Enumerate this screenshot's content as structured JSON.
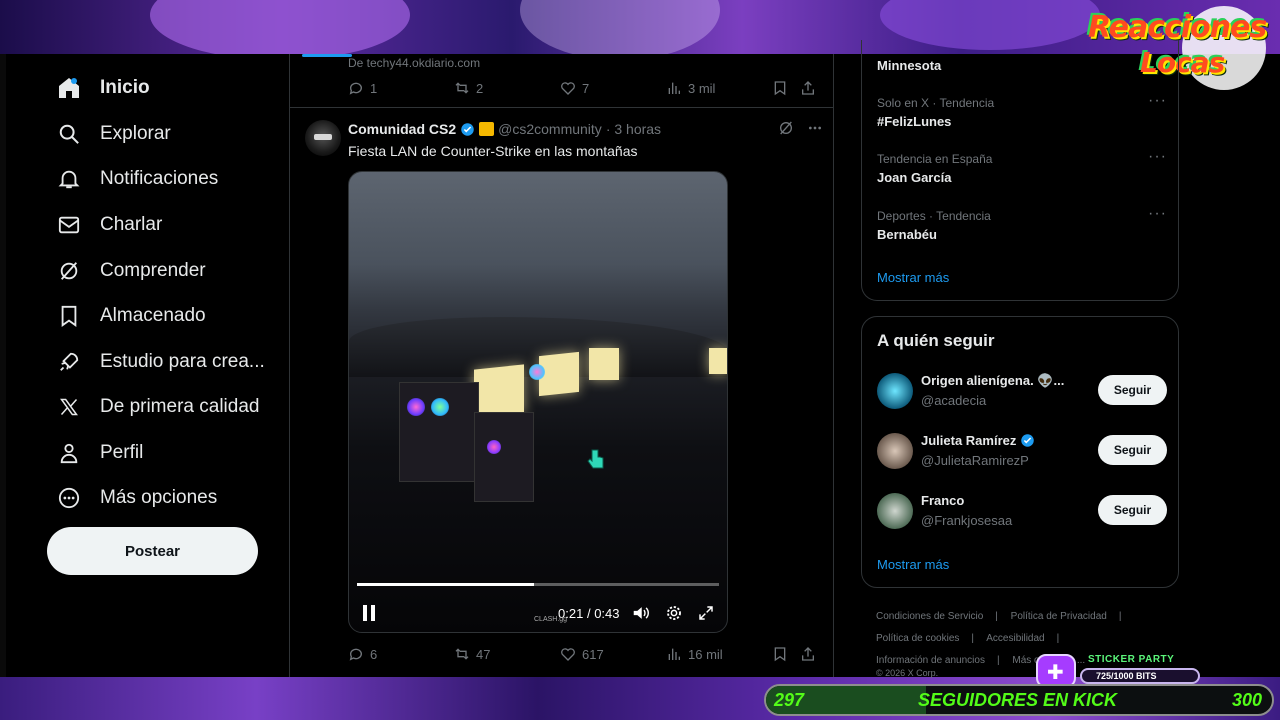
{
  "overlay": {
    "logo_line1": "Reacciones",
    "logo_line2": "Locas",
    "sticker_title": "STICKER PARTY",
    "sticker_bits": "725/1000 BITS",
    "sticker_progress": 0.725,
    "goal_start": "297",
    "goal_label": "SEGUIDORES EN KICK",
    "goal_end": "300",
    "colors": {
      "kick_green": "#53fc18",
      "purple": "#a63cff"
    }
  },
  "sidebar": {
    "items": [
      {
        "icon": "home-icon",
        "label": "Inicio",
        "active": true
      },
      {
        "icon": "search-icon",
        "label": "Explorar"
      },
      {
        "icon": "bell-icon",
        "label": "Notificaciones"
      },
      {
        "icon": "envelope-icon",
        "label": "Charlar"
      },
      {
        "icon": "grok-icon",
        "label": "Comprender"
      },
      {
        "icon": "bookmark-icon",
        "label": "Almacenado"
      },
      {
        "icon": "rocket-icon",
        "label": "Estudio para crea..."
      },
      {
        "icon": "x-logo-icon",
        "label": "De primera calidad"
      },
      {
        "icon": "person-icon",
        "label": "Perfil"
      },
      {
        "icon": "more-circle-icon",
        "label": "Más opciones"
      }
    ],
    "post_button": "Postear"
  },
  "feed": {
    "previous_tweet": {
      "source": "De  techy44.okdiario.com",
      "replies": "1",
      "retweets": "2",
      "likes": "7",
      "views": "3 mil"
    },
    "tweet": {
      "author": "Comunidad CS2",
      "handle": "@cs2community",
      "time": "· 3 horas",
      "text": "Fiesta LAN de Counter-Strike en las montañas",
      "video": {
        "current": "0:21",
        "separator": "/",
        "duration": "0:43",
        "progress": 0.488,
        "watermark": "CLASH.gg"
      },
      "replies": "6",
      "retweets": "47",
      "likes": "617",
      "views": "16 mil"
    }
  },
  "trends": {
    "top_name": "Minnesota",
    "items": [
      {
        "meta": "Solo en X · Tendencia",
        "name": "#FelizLunes"
      },
      {
        "meta": "Tendencia en España",
        "name": "Joan García"
      },
      {
        "meta": "Deportes · Tendencia",
        "name": "Bernabéu"
      }
    ],
    "show_more": "Mostrar más"
  },
  "who_to_follow": {
    "title": "A quién seguir",
    "accounts": [
      {
        "name": "Origen alienígena. 👽...",
        "handle": "@acadecia",
        "verified": false,
        "button": "Seguir"
      },
      {
        "name": "Julieta Ramírez",
        "handle": "@JulietaRamirezP",
        "verified": true,
        "button": "Seguir"
      },
      {
        "name": "Franco",
        "handle": "@Frankjosesaa",
        "verified": false,
        "button": "Seguir"
      }
    ],
    "show_more": "Mostrar más"
  },
  "footer": {
    "links": [
      "Condiciones de Servicio",
      "Política de Privacidad",
      "Política de cookies",
      "Accesibilidad",
      "Información de anuncios",
      "Más opciones ..."
    ],
    "copyright": "© 2026 X Corp."
  }
}
